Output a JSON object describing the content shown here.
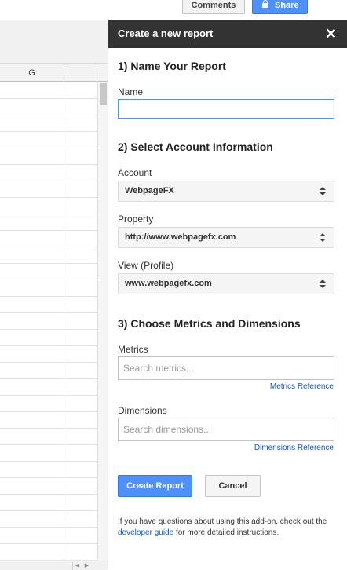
{
  "topbar": {
    "comments_label": "Comments",
    "share_label": "Share"
  },
  "sheet": {
    "column_g": "G"
  },
  "sidebar": {
    "title": "Create a new report",
    "close_glyph": "✕",
    "section1_title": "1) Name Your Report",
    "name_label": "Name",
    "name_value": "",
    "section2_title": "2) Select Account Information",
    "account_label": "Account",
    "account_value": "WebpageFX",
    "property_label": "Property",
    "property_value": "http://www.webpagefx.com",
    "view_label": "View (Profile)",
    "view_value": "www.webpagefx.com",
    "section3_title": "3) Choose Metrics and Dimensions",
    "metrics_label": "Metrics",
    "metrics_placeholder": "Search metrics...",
    "metrics_reference": "Metrics Reference",
    "dimensions_label": "Dimensions",
    "dimensions_placeholder": "Search dimensions...",
    "dimensions_reference": "Dimensions Reference",
    "create_label": "Create Report",
    "cancel_label": "Cancel",
    "help_prefix": "If you have questions about using this add-on, check out the",
    "help_link": "developer guide",
    "help_suffix": "for more detailed instructions."
  },
  "colors": {
    "primary_blue": "#4d90fe",
    "header_dark": "#333333",
    "link_blue": "#1155cc"
  }
}
